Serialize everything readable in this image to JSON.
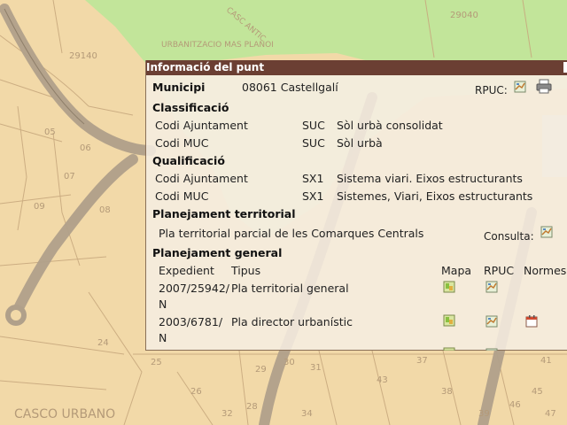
{
  "map": {
    "labels": {
      "urbanitzacio": "URBANITZACIO MAS PLANOI",
      "casc": "CASC ANTIC",
      "casco_urbano": "CASCO URBANO",
      "n_29140": "29140",
      "n_29040": "29040",
      "n_05": "05",
      "n_06": "06",
      "n_07": "07",
      "n_08": "08",
      "n_09": "09",
      "n_24": "24",
      "n_25": "25",
      "n_26": "26",
      "n_28": "28",
      "n_29": "29",
      "n_30": "30",
      "n_31": "31",
      "n_32": "32",
      "n_34": "34",
      "n_37": "37",
      "n_38": "38",
      "n_39": "39",
      "n_41": "41",
      "n_43": "43",
      "n_45": "45",
      "n_46": "46",
      "n_47": "47"
    },
    "colors": {
      "land": "#f2d9a8",
      "green": "#c2e59a",
      "road": "#b0a08a",
      "line": "#c8a97e"
    }
  },
  "popup": {
    "title": "Informació del punt",
    "municipi": {
      "label": "Municipi",
      "value": "08061 Castellgalí",
      "rpuc_label": "RPUC:"
    },
    "classificacio": {
      "heading": "Classificació",
      "rows": [
        {
          "label": "Codi Ajuntament",
          "code": "SUC",
          "desc": "Sòl urbà consolidat"
        },
        {
          "label": "Codi MUC",
          "code": "SUC",
          "desc": "Sòl urbà"
        }
      ]
    },
    "qualificacio": {
      "heading": "Qualificació",
      "rows": [
        {
          "label": "Codi Ajuntament",
          "code": "SX1",
          "desc": "Sistema viari. Eixos estructurants"
        },
        {
          "label": "Codi MUC",
          "code": "SX1",
          "desc": "Sistemes, Viari, Eixos estructurants"
        }
      ]
    },
    "territorial": {
      "heading": "Planejament territorial",
      "plan": "Pla territorial parcial de les Comarques Centrals",
      "consulta_label": "Consulta:"
    },
    "general": {
      "heading": "Planejament general",
      "columns": {
        "expedient": "Expedient",
        "tipus": "Tipus",
        "mapa": "Mapa",
        "rpuc": "RPUC",
        "normes": "Normes"
      },
      "rows": [
        {
          "exp_line1": "2007/25942/",
          "exp_line2": "N",
          "tipus": "Pla territorial general"
        },
        {
          "exp_line1": "2003/6781/",
          "exp_line2": "N",
          "tipus": "Pla director urbanístic"
        }
      ]
    }
  }
}
